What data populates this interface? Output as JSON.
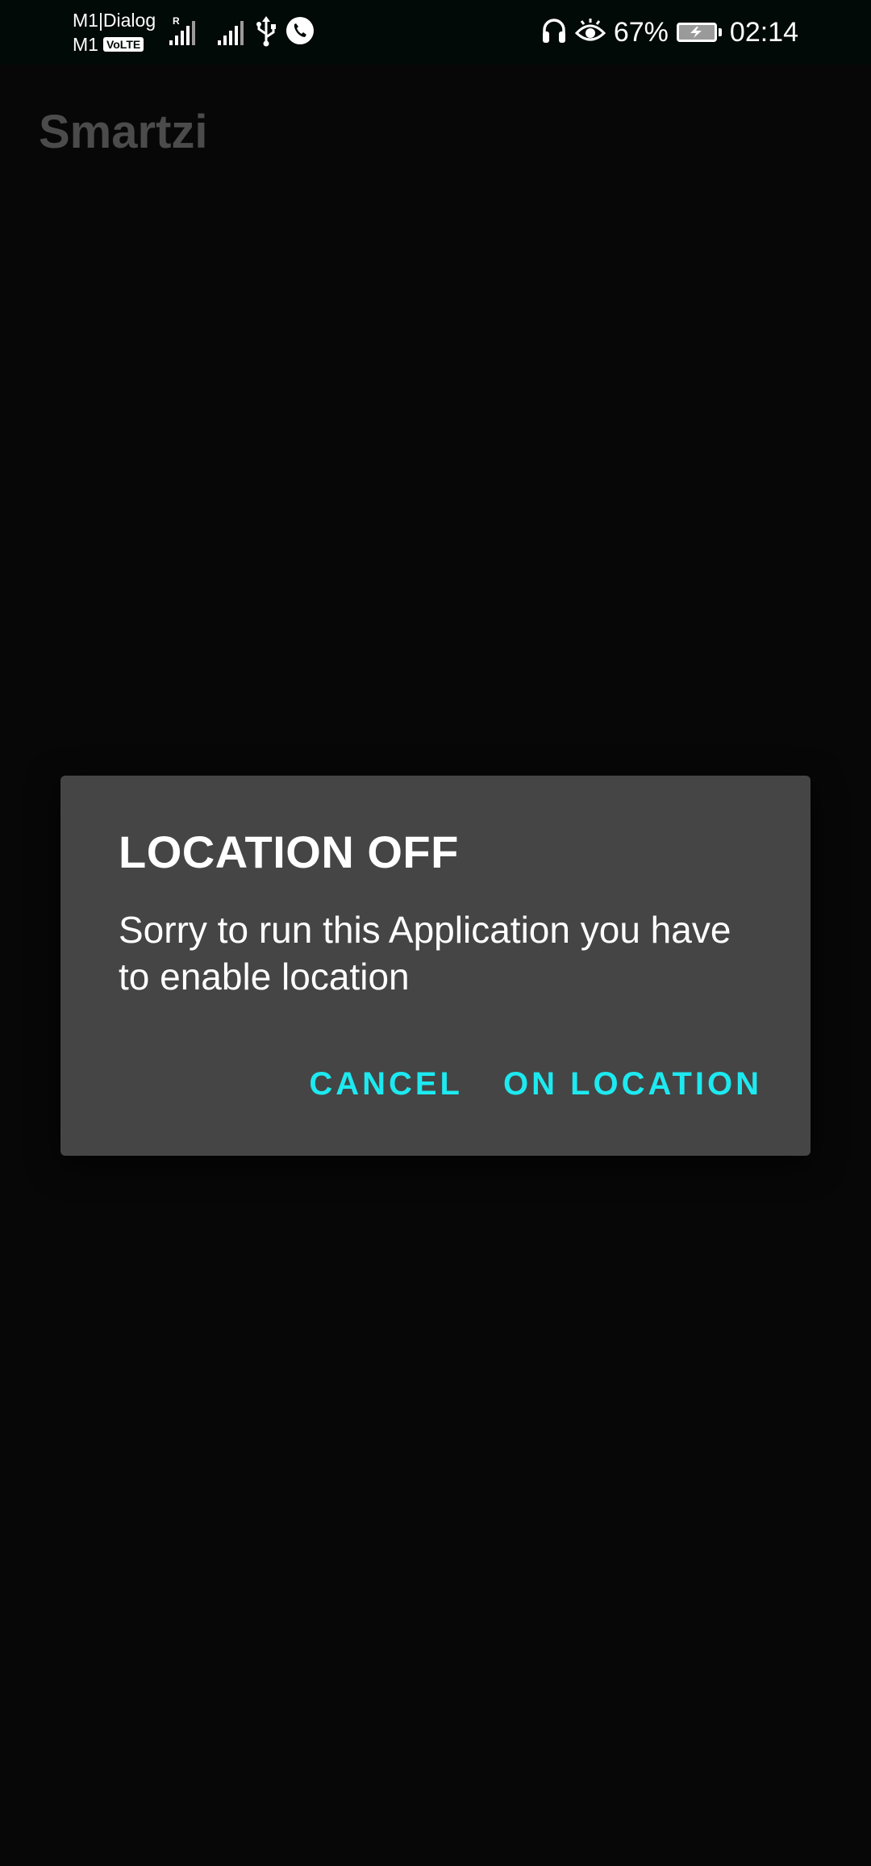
{
  "status_bar": {
    "carrier_line1": "M1|Dialog",
    "carrier_line2": "M1",
    "volte_badge": "VoLTE",
    "roaming_indicator": "R",
    "battery_percent": "67%",
    "clock": "02:14",
    "icons": [
      "signal-icon",
      "signal-icon",
      "usb-icon",
      "whatsapp-call-icon",
      "headset-icon",
      "eye-comfort-icon",
      "battery-charging-icon"
    ]
  },
  "app": {
    "title": "Smartzi"
  },
  "dialog": {
    "title": "LOCATION OFF",
    "message": "Sorry to run this Application you have to enable location",
    "cancel_label": "CANCEL",
    "confirm_label": "ON LOCATION"
  },
  "colors": {
    "background": "#070707",
    "dialog_background": "#454545",
    "accent": "#1de9f0",
    "app_title": "#4b4b4b"
  }
}
